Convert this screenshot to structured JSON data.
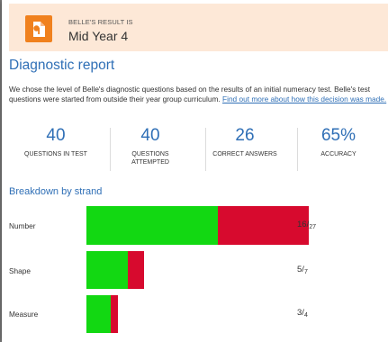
{
  "banner": {
    "caption": "BELLE'S RESULT IS",
    "result": "Mid Year 4",
    "icon": "document-icon",
    "color": "#f0811e"
  },
  "report": {
    "title": "Diagnostic report",
    "intro_text": "We chose the level of Belle's diagnostic questions based on the results of an initial numeracy test. Belle's test questions were started from outside their year group curriculum. ",
    "intro_link": "Find out more about how this decision was made."
  },
  "stats": [
    {
      "value": "40",
      "label": "QUESTIONS IN TEST"
    },
    {
      "value": "40",
      "label": "QUESTIONS ATTEMPTED"
    },
    {
      "value": "26",
      "label": "CORRECT ANSWERS"
    },
    {
      "value": "65%",
      "label": "ACCURACY"
    }
  ],
  "breakdown": {
    "title": "Breakdown by strand",
    "colors": {
      "correct": "#12d812",
      "incorrect": "#d70a2e"
    },
    "strands": [
      {
        "label": "Number",
        "correct": "16",
        "total": "27"
      },
      {
        "label": "Shape",
        "correct": "5",
        "total": "7"
      },
      {
        "label": "Measure",
        "correct": "3",
        "total": "4"
      }
    ]
  }
}
